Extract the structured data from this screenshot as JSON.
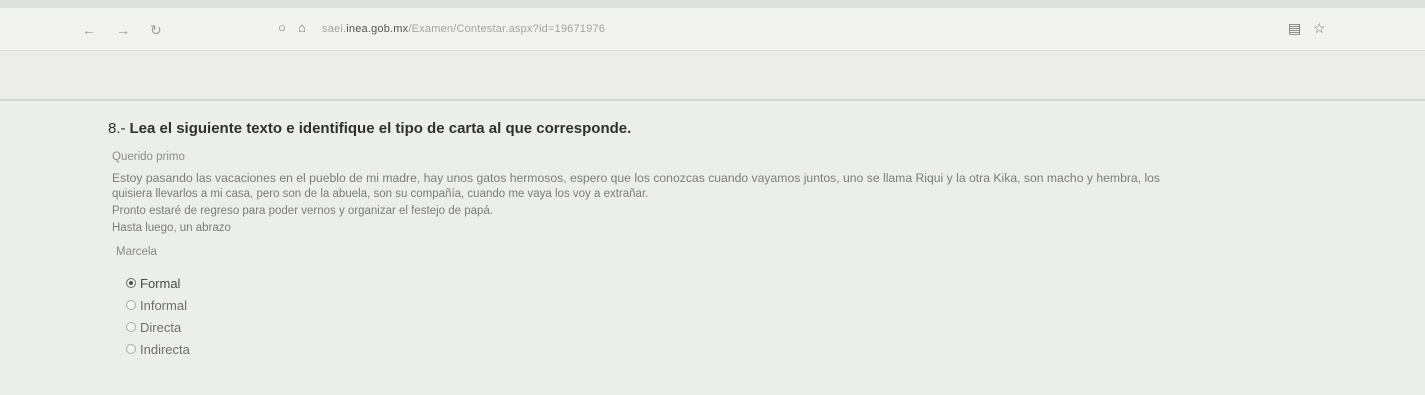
{
  "browser": {
    "url_prefix": "saei.",
    "url_domain": "inea.gob.mx",
    "url_path": "/Examen/Contestar.aspx?id=19671976",
    "back_icon": "arrow-left-icon",
    "forward_icon": "arrow-right-icon",
    "reload_icon": "reload-icon",
    "reader_icon": "reader-view-icon",
    "bookmark_icon": "star-icon"
  },
  "question": {
    "number": "8.-",
    "text": "Lea el siguiente texto e identifique el tipo de carta al que corresponde."
  },
  "letter": {
    "greeting": "Querido primo",
    "line1": "Estoy pasando las vacaciones en el pueblo de mi madre, hay unos gatos hermosos, espero que los conozcas cuando vayamos juntos, uno se llama Riqui y la otra Kika, son macho y hembra, los",
    "line2": "quisiera llevarlos a mi casa, pero son de la abuela, son su compañía, cuando me vaya los voy a extrañar.",
    "line3": "Pronto estaré de regreso para poder vernos y organizar el festejo de papá.",
    "closing": "Hasta luego, un abrazo",
    "signature": "Marcela"
  },
  "options": [
    {
      "label": "Formal",
      "selected": true
    },
    {
      "label": "Informal",
      "selected": false
    },
    {
      "label": "Directa",
      "selected": false
    },
    {
      "label": "Indirecta",
      "selected": false
    }
  ]
}
